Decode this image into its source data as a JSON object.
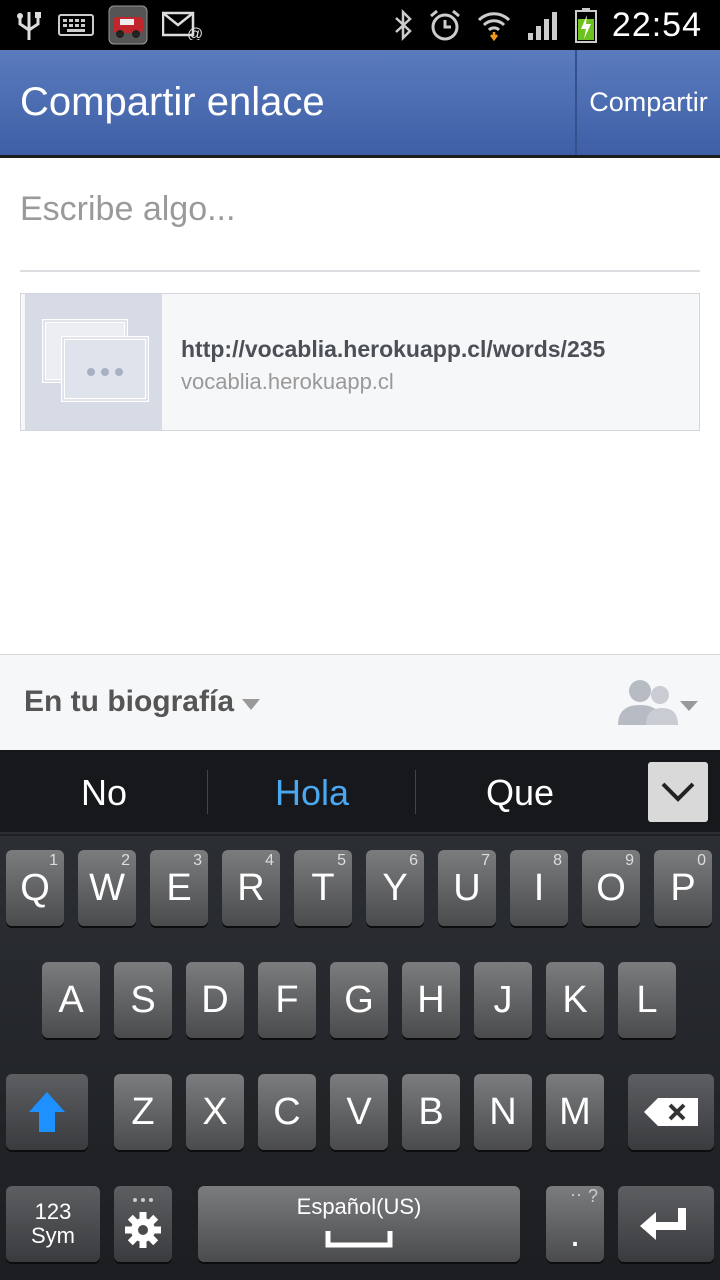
{
  "status_bar": {
    "time": "22:54",
    "left_icons": [
      "usb-icon",
      "keyboard-icon",
      "app-thumbnail-icon",
      "email-icon"
    ],
    "right_icons": [
      "bluetooth-icon",
      "alarm-icon",
      "wifi-icon",
      "signal-icon",
      "battery-charging-icon"
    ]
  },
  "header": {
    "title": "Compartir enlace",
    "action_label": "Compartir",
    "color": "#4a6aae"
  },
  "composer": {
    "placeholder": "Escribe algo..."
  },
  "link_preview": {
    "url": "http://vocablia.herokuapp.cl/words/235",
    "domain": "vocablia.herokuapp.cl"
  },
  "audience": {
    "label": "En tu biografía",
    "friends_icon": "friends-icon"
  },
  "keyboard": {
    "suggestions": [
      "No",
      "Hola",
      "Que"
    ],
    "active_suggestion": "Hola",
    "row1": [
      {
        "letter": "Q",
        "num": "1"
      },
      {
        "letter": "W",
        "num": "2"
      },
      {
        "letter": "E",
        "num": "3"
      },
      {
        "letter": "R",
        "num": "4"
      },
      {
        "letter": "T",
        "num": "5"
      },
      {
        "letter": "Y",
        "num": "6"
      },
      {
        "letter": "U",
        "num": "7"
      },
      {
        "letter": "I",
        "num": "8"
      },
      {
        "letter": "O",
        "num": "9"
      },
      {
        "letter": "P",
        "num": "0"
      }
    ],
    "row2": [
      "A",
      "S",
      "D",
      "F",
      "G",
      "H",
      "J",
      "K",
      "L"
    ],
    "row3": [
      "Z",
      "X",
      "C",
      "V",
      "B",
      "N",
      "M"
    ],
    "sym_line1": "123",
    "sym_line2": "Sym",
    "space_label": "Español(US)",
    "period_label": ".",
    "period_hint": "?",
    "accent_color": "#1e90ff"
  }
}
